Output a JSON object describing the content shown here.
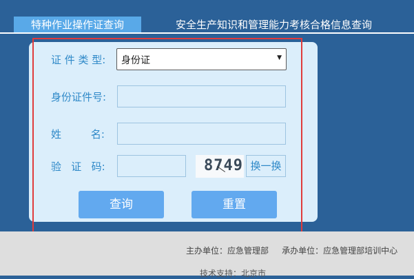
{
  "tabs": [
    {
      "label": "特种作业操作证查询"
    },
    {
      "label": "安全生产知识和管理能力考核合格信息查询"
    }
  ],
  "form": {
    "cert_type_label": "证 件 类 型:",
    "cert_type_value": "身份证",
    "id_label": "身份证件号:",
    "name_label": "姓         名:",
    "captcha_label": "验   证   码:",
    "captcha_code": "8749",
    "refresh_label": "换一换",
    "query_button": "查询",
    "reset_button": "重置"
  },
  "footer": {
    "host": "主办单位：应急管理部",
    "organizer": "承办单位：应急管理部培训中心",
    "partial_line": "技术支持：北京市"
  },
  "colors": {
    "background": "#2b6198",
    "active_tab": "#59a9e8",
    "panel": "#dbeefb",
    "button": "#62a9ef",
    "label": "#2f89c8",
    "highlight": "#e03b3b"
  },
  "icons": {
    "select_arrow": "caret-down-icon"
  }
}
